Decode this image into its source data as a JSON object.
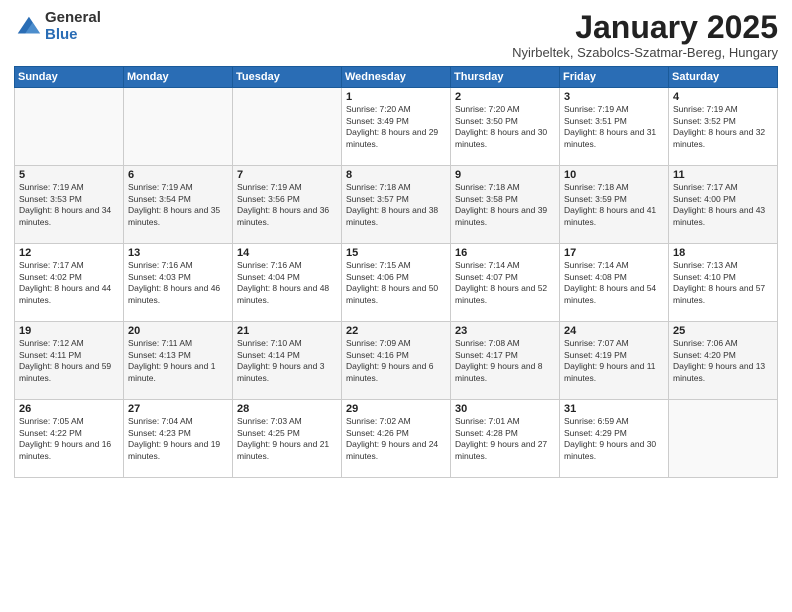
{
  "logo": {
    "general": "General",
    "blue": "Blue"
  },
  "title": "January 2025",
  "subtitle": "Nyirbeltek, Szabolcs-Szatmar-Bereg, Hungary",
  "headers": [
    "Sunday",
    "Monday",
    "Tuesday",
    "Wednesday",
    "Thursday",
    "Friday",
    "Saturday"
  ],
  "weeks": [
    [
      {
        "day": "",
        "info": ""
      },
      {
        "day": "",
        "info": ""
      },
      {
        "day": "",
        "info": ""
      },
      {
        "day": "1",
        "info": "Sunrise: 7:20 AM\nSunset: 3:49 PM\nDaylight: 8 hours and 29 minutes."
      },
      {
        "day": "2",
        "info": "Sunrise: 7:20 AM\nSunset: 3:50 PM\nDaylight: 8 hours and 30 minutes."
      },
      {
        "day": "3",
        "info": "Sunrise: 7:19 AM\nSunset: 3:51 PM\nDaylight: 8 hours and 31 minutes."
      },
      {
        "day": "4",
        "info": "Sunrise: 7:19 AM\nSunset: 3:52 PM\nDaylight: 8 hours and 32 minutes."
      }
    ],
    [
      {
        "day": "5",
        "info": "Sunrise: 7:19 AM\nSunset: 3:53 PM\nDaylight: 8 hours and 34 minutes."
      },
      {
        "day": "6",
        "info": "Sunrise: 7:19 AM\nSunset: 3:54 PM\nDaylight: 8 hours and 35 minutes."
      },
      {
        "day": "7",
        "info": "Sunrise: 7:19 AM\nSunset: 3:56 PM\nDaylight: 8 hours and 36 minutes."
      },
      {
        "day": "8",
        "info": "Sunrise: 7:18 AM\nSunset: 3:57 PM\nDaylight: 8 hours and 38 minutes."
      },
      {
        "day": "9",
        "info": "Sunrise: 7:18 AM\nSunset: 3:58 PM\nDaylight: 8 hours and 39 minutes."
      },
      {
        "day": "10",
        "info": "Sunrise: 7:18 AM\nSunset: 3:59 PM\nDaylight: 8 hours and 41 minutes."
      },
      {
        "day": "11",
        "info": "Sunrise: 7:17 AM\nSunset: 4:00 PM\nDaylight: 8 hours and 43 minutes."
      }
    ],
    [
      {
        "day": "12",
        "info": "Sunrise: 7:17 AM\nSunset: 4:02 PM\nDaylight: 8 hours and 44 minutes."
      },
      {
        "day": "13",
        "info": "Sunrise: 7:16 AM\nSunset: 4:03 PM\nDaylight: 8 hours and 46 minutes."
      },
      {
        "day": "14",
        "info": "Sunrise: 7:16 AM\nSunset: 4:04 PM\nDaylight: 8 hours and 48 minutes."
      },
      {
        "day": "15",
        "info": "Sunrise: 7:15 AM\nSunset: 4:06 PM\nDaylight: 8 hours and 50 minutes."
      },
      {
        "day": "16",
        "info": "Sunrise: 7:14 AM\nSunset: 4:07 PM\nDaylight: 8 hours and 52 minutes."
      },
      {
        "day": "17",
        "info": "Sunrise: 7:14 AM\nSunset: 4:08 PM\nDaylight: 8 hours and 54 minutes."
      },
      {
        "day": "18",
        "info": "Sunrise: 7:13 AM\nSunset: 4:10 PM\nDaylight: 8 hours and 57 minutes."
      }
    ],
    [
      {
        "day": "19",
        "info": "Sunrise: 7:12 AM\nSunset: 4:11 PM\nDaylight: 8 hours and 59 minutes."
      },
      {
        "day": "20",
        "info": "Sunrise: 7:11 AM\nSunset: 4:13 PM\nDaylight: 9 hours and 1 minute."
      },
      {
        "day": "21",
        "info": "Sunrise: 7:10 AM\nSunset: 4:14 PM\nDaylight: 9 hours and 3 minutes."
      },
      {
        "day": "22",
        "info": "Sunrise: 7:09 AM\nSunset: 4:16 PM\nDaylight: 9 hours and 6 minutes."
      },
      {
        "day": "23",
        "info": "Sunrise: 7:08 AM\nSunset: 4:17 PM\nDaylight: 9 hours and 8 minutes."
      },
      {
        "day": "24",
        "info": "Sunrise: 7:07 AM\nSunset: 4:19 PM\nDaylight: 9 hours and 11 minutes."
      },
      {
        "day": "25",
        "info": "Sunrise: 7:06 AM\nSunset: 4:20 PM\nDaylight: 9 hours and 13 minutes."
      }
    ],
    [
      {
        "day": "26",
        "info": "Sunrise: 7:05 AM\nSunset: 4:22 PM\nDaylight: 9 hours and 16 minutes."
      },
      {
        "day": "27",
        "info": "Sunrise: 7:04 AM\nSunset: 4:23 PM\nDaylight: 9 hours and 19 minutes."
      },
      {
        "day": "28",
        "info": "Sunrise: 7:03 AM\nSunset: 4:25 PM\nDaylight: 9 hours and 21 minutes."
      },
      {
        "day": "29",
        "info": "Sunrise: 7:02 AM\nSunset: 4:26 PM\nDaylight: 9 hours and 24 minutes."
      },
      {
        "day": "30",
        "info": "Sunrise: 7:01 AM\nSunset: 4:28 PM\nDaylight: 9 hours and 27 minutes."
      },
      {
        "day": "31",
        "info": "Sunrise: 6:59 AM\nSunset: 4:29 PM\nDaylight: 9 hours and 30 minutes."
      },
      {
        "day": "",
        "info": ""
      }
    ]
  ]
}
